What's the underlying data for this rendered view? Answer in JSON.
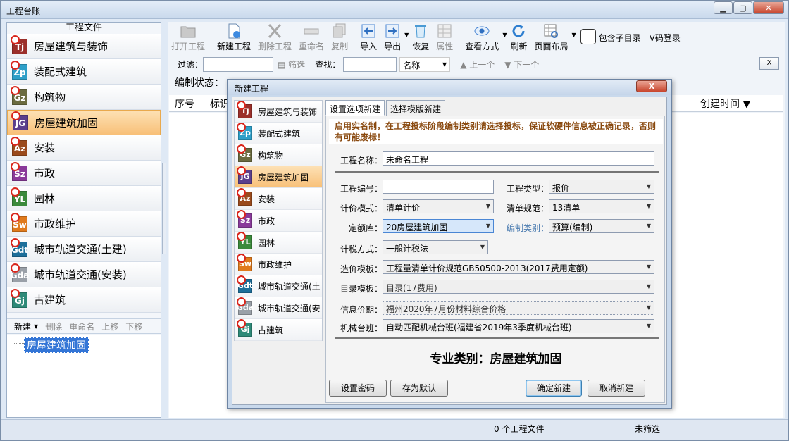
{
  "window": {
    "title": "工程台账"
  },
  "left_panel": {
    "header": "工程文件",
    "categories": [
      {
        "code": "Tj",
        "label": "房屋建筑与装饰",
        "color": "#9b2f2a"
      },
      {
        "code": "Zp",
        "label": "装配式建筑",
        "color": "#2e9fc8"
      },
      {
        "code": "Gz",
        "label": "构筑物",
        "color": "#6b6b3f"
      },
      {
        "code": "JG",
        "label": "房屋建筑加固",
        "color": "#5b3e8c"
      },
      {
        "code": "Az",
        "label": "安装",
        "color": "#9a4a1c"
      },
      {
        "code": "Sz",
        "label": "市政",
        "color": "#8a3a9a"
      },
      {
        "code": "YL",
        "label": "园林",
        "color": "#3b8a3b"
      },
      {
        "code": "Sw",
        "label": "市政维护",
        "color": "#e07a1c"
      },
      {
        "code": "Gdt",
        "label": "城市轨道交通(土建)",
        "color": "#1d6f9a"
      },
      {
        "code": "Gda",
        "label": "城市轨道交通(安装)",
        "color": "#9aa0a8"
      },
      {
        "code": "Gj",
        "label": "古建筑",
        "color": "#2e8a78"
      }
    ],
    "toolbar": {
      "new": "新建",
      "delete": "删除",
      "rename": "重命名",
      "up": "上移",
      "down": "下移"
    },
    "tree_selected": "房屋建筑加固"
  },
  "toolbar": {
    "open": "打开工程",
    "new": "新建工程",
    "delete": "删除工程",
    "rename": "重命名",
    "copy": "复制",
    "import": "导入",
    "export": "导出",
    "restore": "恢复",
    "properties": "属性",
    "view": "查看方式",
    "refresh": "刷新",
    "layout": "页面布局",
    "include_sub": "包含子目录",
    "vlogin": "V码登录"
  },
  "filter": {
    "label": "过滤：",
    "filter_btn": "筛选",
    "find_label": "查找：",
    "field": "名称",
    "prev": "上一个",
    "next": "下一个",
    "close": "X"
  },
  "status_label": "编制状态：",
  "grid": {
    "col_index": "序号",
    "col_mark": "标识",
    "col_created": "创建时间"
  },
  "statusbar": {
    "count": "0 个工程文件",
    "filter": "未筛选"
  },
  "dialog": {
    "title": "新建工程",
    "close": "X",
    "categories": [
      {
        "code": "Tj",
        "label": "房屋建筑与装饰",
        "color": "#9b2f2a"
      },
      {
        "code": "Zp",
        "label": "装配式建筑",
        "color": "#2e9fc8"
      },
      {
        "code": "Gz",
        "label": "构筑物",
        "color": "#6b6b3f"
      },
      {
        "code": "JG",
        "label": "房屋建筑加固",
        "color": "#5b3e8c"
      },
      {
        "code": "Az",
        "label": "安装",
        "color": "#9a4a1c"
      },
      {
        "code": "Sz",
        "label": "市政",
        "color": "#8a3a9a"
      },
      {
        "code": "YL",
        "label": "园林",
        "color": "#3b8a3b"
      },
      {
        "code": "Sw",
        "label": "市政维护",
        "color": "#e07a1c"
      },
      {
        "code": "Gdt",
        "label": "城市轨道交通(土",
        "color": "#1d6f9a"
      },
      {
        "code": "Gda",
        "label": "城市轨道交通(安",
        "color": "#9aa0a8"
      },
      {
        "code": "Gj",
        "label": "古建筑",
        "color": "#2e8a78"
      }
    ],
    "tab_options": "设置选项新建",
    "tab_template": "选择模版新建",
    "notice": "启用实名制，在工程投标阶段编制类别请选择投标，保证软硬件信息被正确记录，否则有可能废标！",
    "fields": {
      "name_label": "工程名称：",
      "name_value": "未命名工程",
      "code_label": "工程编号：",
      "code_value": "",
      "type_label": "工程类型：",
      "type_value": "报价",
      "pricing_label": "计价模式：",
      "pricing_value": "清单计价",
      "spec_label": "清单规范：",
      "spec_value": "13清单",
      "quota_label": "定额库：",
      "quota_value": "20房屋建筑加固",
      "category_label": "编制类别：",
      "category_value": "预算(编制)",
      "tax_label": "计税方式：",
      "tax_value": "一般计税法",
      "cost_tpl_label": "造价模板：",
      "cost_tpl_value": "工程量清单计价规范GB50500-2013(2017费用定额)",
      "dir_tpl_label": "目录模板：",
      "dir_tpl_value": "目录(17费用)",
      "price_label": "信息价期：",
      "price_value": "福州2020年7月份材料综合价格",
      "machine_label": "机械台班：",
      "machine_value": "自动匹配机械台班(福建省2019年3季度机械台班)"
    },
    "specialty": "专业类别：房屋建筑加固",
    "buttons": {
      "password": "设置密码",
      "save_default": "存为默认",
      "confirm": "确定新建",
      "cancel": "取消新建"
    }
  }
}
